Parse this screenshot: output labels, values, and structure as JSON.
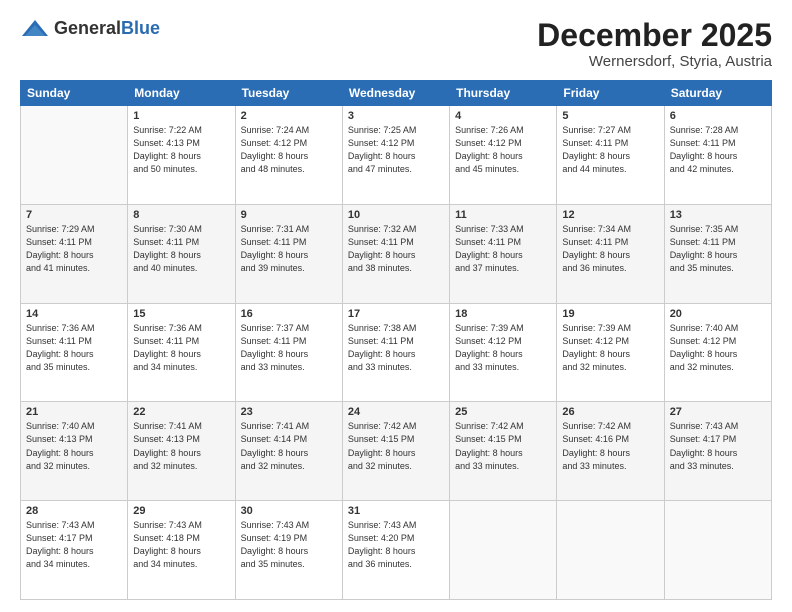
{
  "header": {
    "logo_general": "General",
    "logo_blue": "Blue",
    "month": "December 2025",
    "location": "Wernersdorf, Styria, Austria"
  },
  "days_of_week": [
    "Sunday",
    "Monday",
    "Tuesday",
    "Wednesday",
    "Thursday",
    "Friday",
    "Saturday"
  ],
  "weeks": [
    [
      {
        "day": "",
        "text": ""
      },
      {
        "day": "1",
        "text": "Sunrise: 7:22 AM\nSunset: 4:13 PM\nDaylight: 8 hours\nand 50 minutes."
      },
      {
        "day": "2",
        "text": "Sunrise: 7:24 AM\nSunset: 4:12 PM\nDaylight: 8 hours\nand 48 minutes."
      },
      {
        "day": "3",
        "text": "Sunrise: 7:25 AM\nSunset: 4:12 PM\nDaylight: 8 hours\nand 47 minutes."
      },
      {
        "day": "4",
        "text": "Sunrise: 7:26 AM\nSunset: 4:12 PM\nDaylight: 8 hours\nand 45 minutes."
      },
      {
        "day": "5",
        "text": "Sunrise: 7:27 AM\nSunset: 4:11 PM\nDaylight: 8 hours\nand 44 minutes."
      },
      {
        "day": "6",
        "text": "Sunrise: 7:28 AM\nSunset: 4:11 PM\nDaylight: 8 hours\nand 42 minutes."
      }
    ],
    [
      {
        "day": "7",
        "text": "Sunrise: 7:29 AM\nSunset: 4:11 PM\nDaylight: 8 hours\nand 41 minutes."
      },
      {
        "day": "8",
        "text": "Sunrise: 7:30 AM\nSunset: 4:11 PM\nDaylight: 8 hours\nand 40 minutes."
      },
      {
        "day": "9",
        "text": "Sunrise: 7:31 AM\nSunset: 4:11 PM\nDaylight: 8 hours\nand 39 minutes."
      },
      {
        "day": "10",
        "text": "Sunrise: 7:32 AM\nSunset: 4:11 PM\nDaylight: 8 hours\nand 38 minutes."
      },
      {
        "day": "11",
        "text": "Sunrise: 7:33 AM\nSunset: 4:11 PM\nDaylight: 8 hours\nand 37 minutes."
      },
      {
        "day": "12",
        "text": "Sunrise: 7:34 AM\nSunset: 4:11 PM\nDaylight: 8 hours\nand 36 minutes."
      },
      {
        "day": "13",
        "text": "Sunrise: 7:35 AM\nSunset: 4:11 PM\nDaylight: 8 hours\nand 35 minutes."
      }
    ],
    [
      {
        "day": "14",
        "text": "Sunrise: 7:36 AM\nSunset: 4:11 PM\nDaylight: 8 hours\nand 35 minutes."
      },
      {
        "day": "15",
        "text": "Sunrise: 7:36 AM\nSunset: 4:11 PM\nDaylight: 8 hours\nand 34 minutes."
      },
      {
        "day": "16",
        "text": "Sunrise: 7:37 AM\nSunset: 4:11 PM\nDaylight: 8 hours\nand 33 minutes."
      },
      {
        "day": "17",
        "text": "Sunrise: 7:38 AM\nSunset: 4:11 PM\nDaylight: 8 hours\nand 33 minutes."
      },
      {
        "day": "18",
        "text": "Sunrise: 7:39 AM\nSunset: 4:12 PM\nDaylight: 8 hours\nand 33 minutes."
      },
      {
        "day": "19",
        "text": "Sunrise: 7:39 AM\nSunset: 4:12 PM\nDaylight: 8 hours\nand 32 minutes."
      },
      {
        "day": "20",
        "text": "Sunrise: 7:40 AM\nSunset: 4:12 PM\nDaylight: 8 hours\nand 32 minutes."
      }
    ],
    [
      {
        "day": "21",
        "text": "Sunrise: 7:40 AM\nSunset: 4:13 PM\nDaylight: 8 hours\nand 32 minutes."
      },
      {
        "day": "22",
        "text": "Sunrise: 7:41 AM\nSunset: 4:13 PM\nDaylight: 8 hours\nand 32 minutes."
      },
      {
        "day": "23",
        "text": "Sunrise: 7:41 AM\nSunset: 4:14 PM\nDaylight: 8 hours\nand 32 minutes."
      },
      {
        "day": "24",
        "text": "Sunrise: 7:42 AM\nSunset: 4:15 PM\nDaylight: 8 hours\nand 32 minutes."
      },
      {
        "day": "25",
        "text": "Sunrise: 7:42 AM\nSunset: 4:15 PM\nDaylight: 8 hours\nand 33 minutes."
      },
      {
        "day": "26",
        "text": "Sunrise: 7:42 AM\nSunset: 4:16 PM\nDaylight: 8 hours\nand 33 minutes."
      },
      {
        "day": "27",
        "text": "Sunrise: 7:43 AM\nSunset: 4:17 PM\nDaylight: 8 hours\nand 33 minutes."
      }
    ],
    [
      {
        "day": "28",
        "text": "Sunrise: 7:43 AM\nSunset: 4:17 PM\nDaylight: 8 hours\nand 34 minutes."
      },
      {
        "day": "29",
        "text": "Sunrise: 7:43 AM\nSunset: 4:18 PM\nDaylight: 8 hours\nand 34 minutes."
      },
      {
        "day": "30",
        "text": "Sunrise: 7:43 AM\nSunset: 4:19 PM\nDaylight: 8 hours\nand 35 minutes."
      },
      {
        "day": "31",
        "text": "Sunrise: 7:43 AM\nSunset: 4:20 PM\nDaylight: 8 hours\nand 36 minutes."
      },
      {
        "day": "",
        "text": ""
      },
      {
        "day": "",
        "text": ""
      },
      {
        "day": "",
        "text": ""
      }
    ]
  ]
}
